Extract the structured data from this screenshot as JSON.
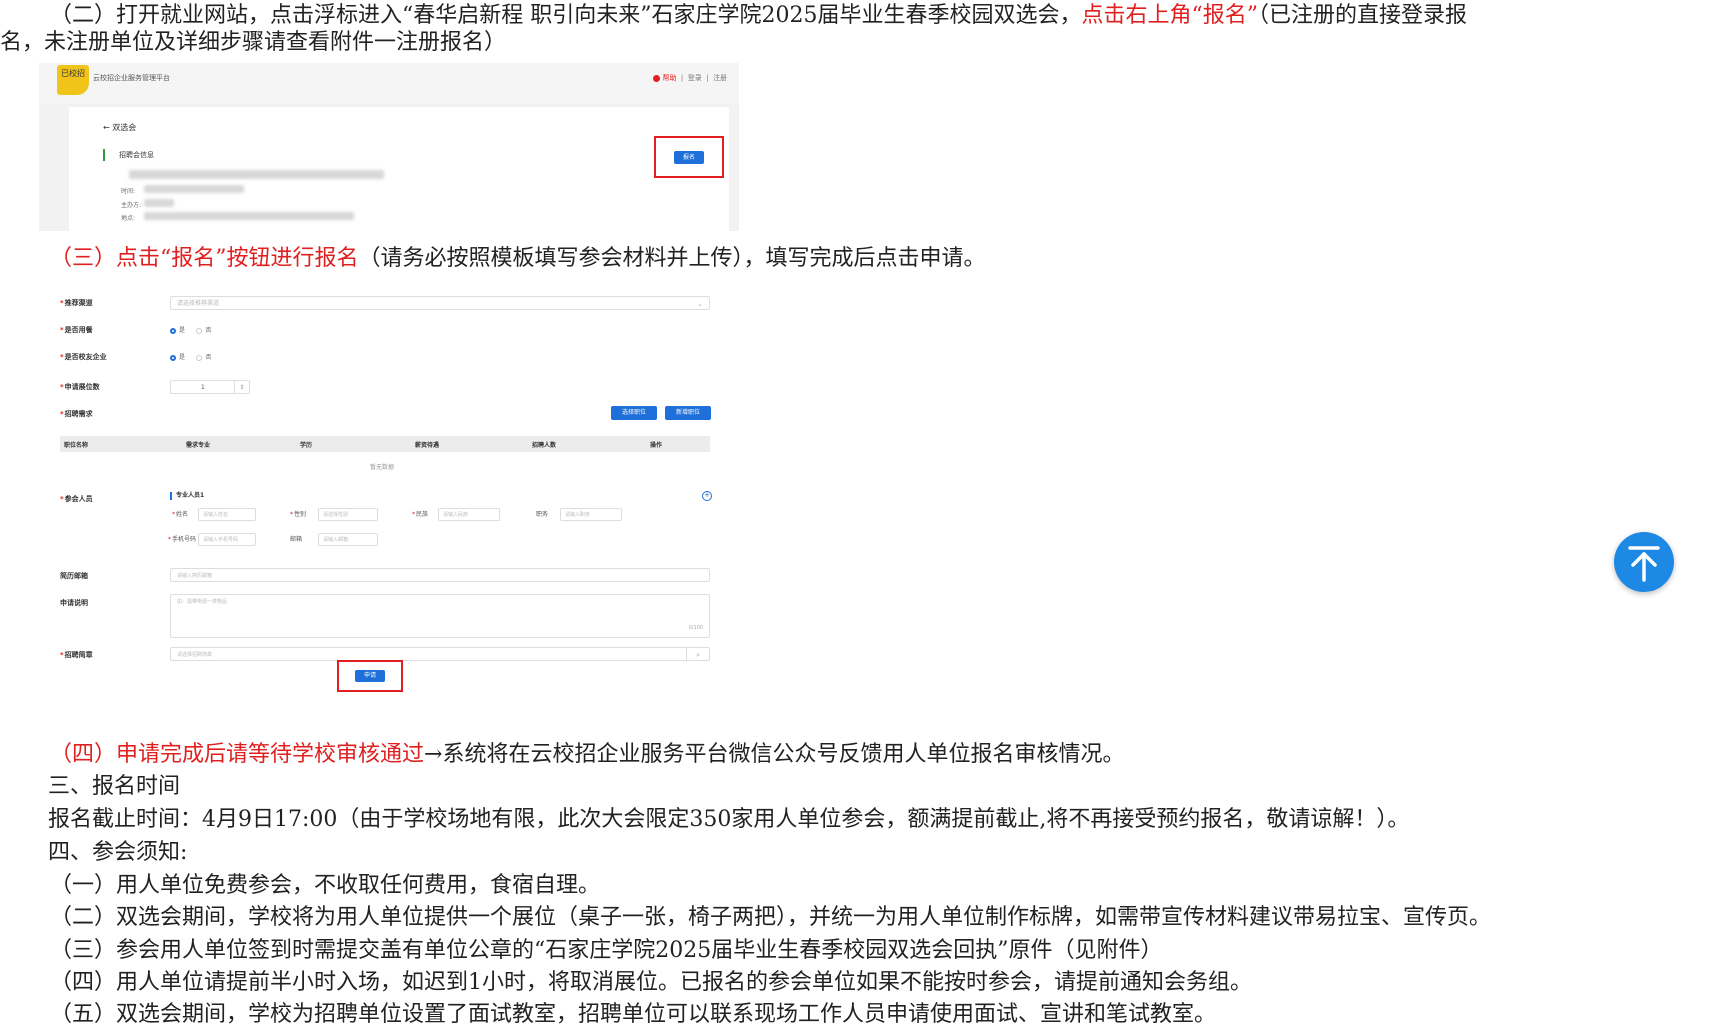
{
  "intro": {
    "line1_a": "（二）打开就业网站，点击浮标进入“春华启新程 职引向未来”石家庄学院2025届毕业生春季校园双选会，",
    "line1_red": "点击右上角“报名”",
    "line1_b": "（已注册的直接登录报",
    "line2": "名，未注册单位及详细步骤请查看附件一注册报名）"
  },
  "screenshot1": {
    "logo_text": "已校招",
    "platform_name": "云校招企业服务管理平台",
    "top_links": {
      "help": "帮助",
      "login": "登录",
      "register": "注册"
    },
    "back_label": "双选会",
    "section_title": "招聘会信息",
    "field_labels": [
      "时间:",
      "主办方:",
      "地点:"
    ],
    "signup_button": "报名"
  },
  "step3": {
    "red": "（三）点击“报名”按钮进行报名",
    "rest": "（请务必按照模板填写参会材料并上传），填写完成后点击申请。"
  },
  "screenshot2": {
    "rows": {
      "channel": "推荐渠道",
      "channel_placeholder": "请选择推荐渠道",
      "hiring": "是否用餐",
      "alumni": "是否校友企业",
      "booths": "申请展位数",
      "booth_value": "1",
      "positions": "招聘需求",
      "attendees": "参会人员",
      "resume_email": "简历邮箱",
      "resume_email_placeholder": "请输入简历邮箱",
      "notes": "申请说明",
      "notes_placeholder": "如：需带电源一类物品",
      "notes_counter": "0/100",
      "brochure": "招聘简章",
      "brochure_placeholder": "请选择招聘简章"
    },
    "radio_yes": "是",
    "radio_no": "否",
    "buttons": {
      "select_position": "选择职位",
      "add_position": "新增职位",
      "apply": "申请"
    },
    "table_headers": [
      "职位名称",
      "需求专业",
      "学历",
      "薪资待遇",
      "招聘人数",
      "操作"
    ],
    "empty_text": "暂无数据",
    "attendee_title": "专业人员1",
    "attendee_fields": [
      {
        "label": "姓名",
        "placeholder": "请输入姓名"
      },
      {
        "label": "性别",
        "placeholder": "请选择性别"
      },
      {
        "label": "民族",
        "placeholder": "请输入民族"
      },
      {
        "label": "职务",
        "placeholder": "请输入职务"
      },
      {
        "label": "手机号码",
        "placeholder": "请输入手机号码"
      },
      {
        "label": "邮箱",
        "placeholder": "请输入邮箱"
      }
    ]
  },
  "step4": {
    "red": "（四）申请完成后请等待学校审核通过",
    "rest": "→系统将在云校招企业服务平台微信公众号反馈用人单位报名审核情况。"
  },
  "section3_title": "三、报名时间",
  "deadline": "报名截止时间：4月9日17:00（由于学校场地有限，此次大会限定350家用人单位参会，额满提前截止,将不再接受预约报名，敬请谅解！）。",
  "section4_title": "四、参会须知:",
  "notes": [
    "（一）用人单位免费参会，不收取任何费用，食宿自理。",
    "（二）双选会期间，学校将为用人单位提供一个展位（桌子一张，椅子两把），并统一为用人单位制作标牌，如需带宣传材料建议带易拉宝、宣传页。",
    "（三）参会用人单位签到时需提交盖有单位公章的“石家庄学院2025届毕业生春季校园双选会回执”原件（见附件）",
    "（四）用人单位请提前半小时入场，如迟到1小时，将取消展位。已报名的参会单位如果不能按时参会，请提前通知会务组。",
    "（五）双选会期间，学校为招聘单位设置了面试教室，招聘单位可以联系现场工作人员申请使用面试、宣讲和笔试教室。"
  ]
}
